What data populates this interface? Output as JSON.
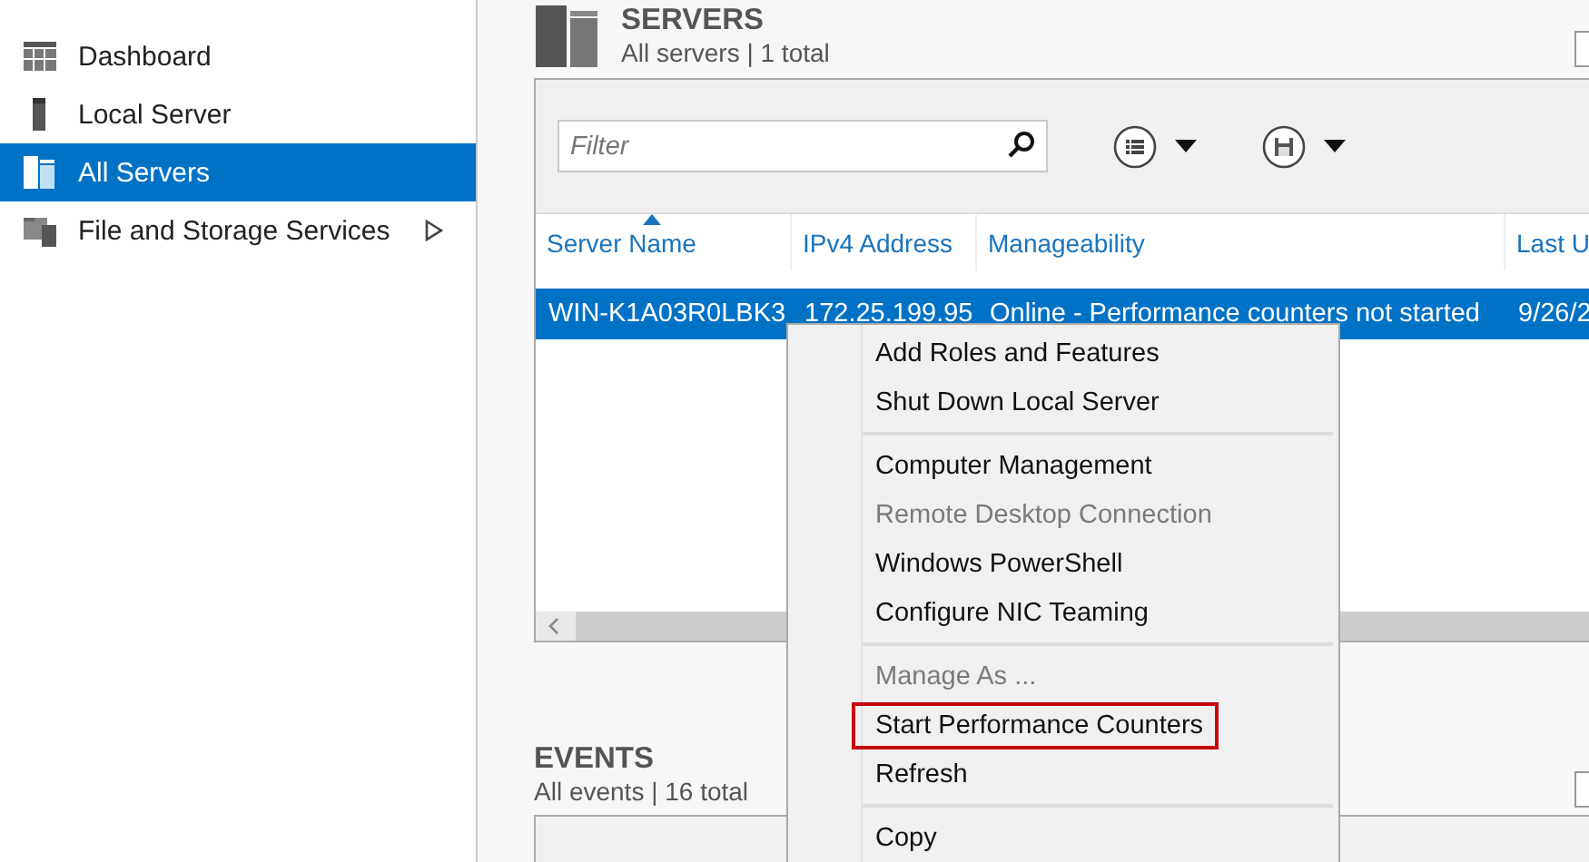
{
  "sidebar": {
    "items": [
      {
        "label": "Dashboard",
        "selected": false,
        "expandable": false
      },
      {
        "label": "Local Server",
        "selected": false,
        "expandable": false
      },
      {
        "label": "All Servers",
        "selected": true,
        "expandable": false
      },
      {
        "label": "File and Storage Services",
        "selected": false,
        "expandable": true
      }
    ]
  },
  "servers": {
    "title": "SERVERS",
    "subtitle": "All servers | 1 total",
    "filter": {
      "placeholder": "Filter"
    },
    "table": {
      "columns": [
        {
          "label": "Server Name",
          "sorted": true
        },
        {
          "label": "IPv4 Address",
          "sorted": false
        },
        {
          "label": "Manageability",
          "sorted": false
        },
        {
          "label": "Last U",
          "sorted": false
        }
      ],
      "rows": [
        {
          "cells": [
            "WIN-K1A03R0LBK3",
            "172.25.199.95",
            "Online - Performance counters not started",
            "9/26/2"
          ],
          "selected": true
        }
      ]
    }
  },
  "events": {
    "title": "EVENTS",
    "subtitle": "All events | 16 total"
  },
  "context_menu": {
    "items": [
      {
        "kind": "item",
        "label": "Add Roles and Features",
        "disabled": false,
        "outlined": false
      },
      {
        "kind": "item",
        "label": "Shut Down Local Server",
        "disabled": false,
        "outlined": false
      },
      {
        "kind": "separator"
      },
      {
        "kind": "item",
        "label": "Computer Management",
        "disabled": false,
        "outlined": false
      },
      {
        "kind": "item",
        "label": "Remote Desktop Connection",
        "disabled": true,
        "outlined": false
      },
      {
        "kind": "item",
        "label": "Windows PowerShell",
        "disabled": false,
        "outlined": false
      },
      {
        "kind": "item",
        "label": "Configure NIC Teaming",
        "disabled": false,
        "outlined": false
      },
      {
        "kind": "separator"
      },
      {
        "kind": "item",
        "label": "Manage As ...",
        "disabled": true,
        "outlined": false
      },
      {
        "kind": "item",
        "label": "Start Performance Counters",
        "disabled": false,
        "outlined": true
      },
      {
        "kind": "item",
        "label": "Refresh",
        "disabled": false,
        "outlined": false
      },
      {
        "kind": "separator"
      },
      {
        "kind": "item",
        "label": "Copy",
        "disabled": false,
        "outlined": false
      }
    ]
  }
}
